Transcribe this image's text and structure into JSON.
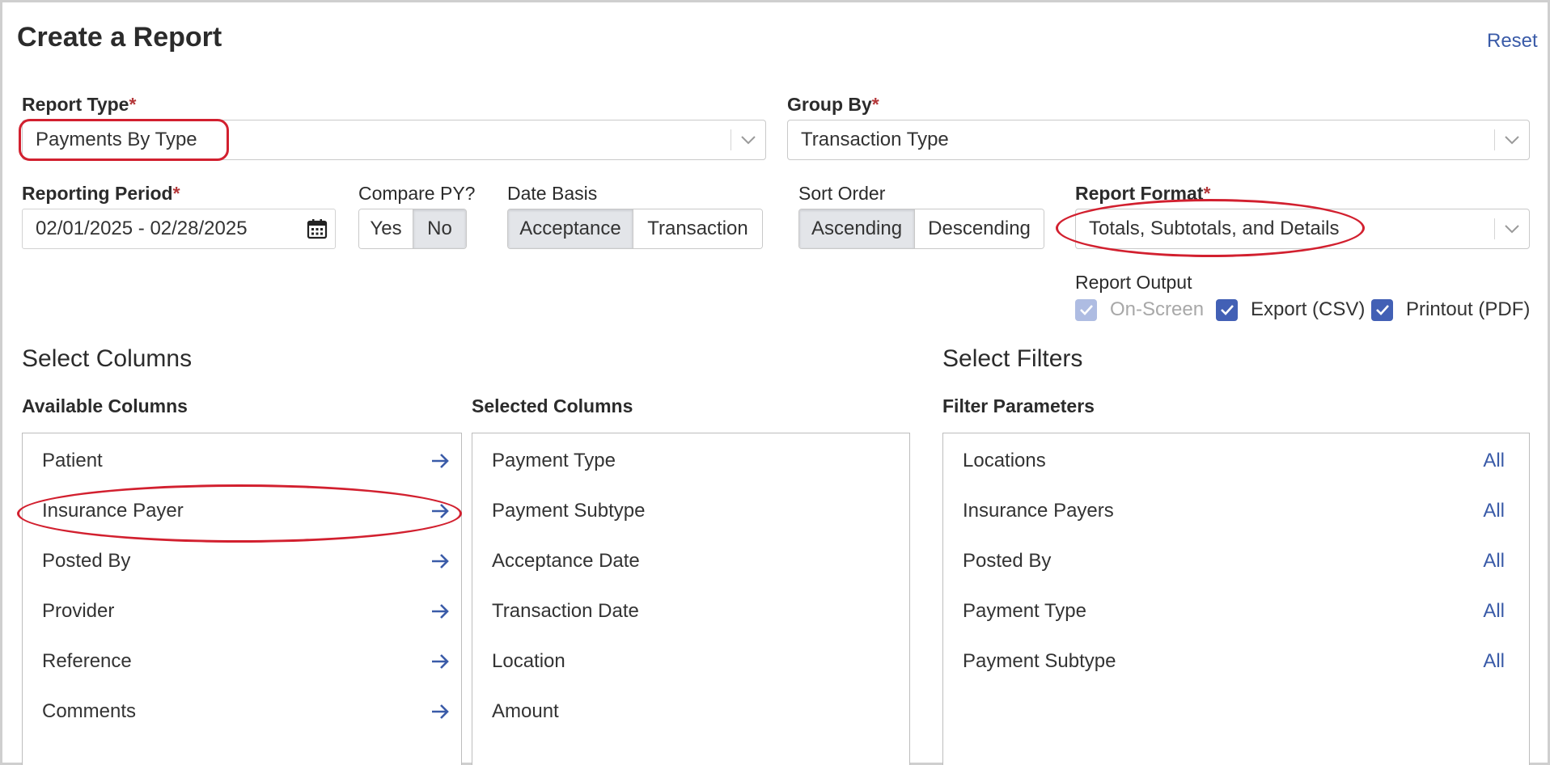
{
  "header": {
    "title": "Create a Report",
    "reset_label": "Reset"
  },
  "report_type": {
    "label": "Report Type",
    "required_mark": "*",
    "value": "Payments By Type"
  },
  "group_by": {
    "label": "Group By",
    "required_mark": "*",
    "value": "Transaction Type"
  },
  "reporting_period": {
    "label": "Reporting Period",
    "required_mark": "*",
    "value": "02/01/2025 - 02/28/2025"
  },
  "compare_py": {
    "label": "Compare PY?",
    "options": [
      "Yes",
      "No"
    ],
    "selected": "No"
  },
  "date_basis": {
    "label": "Date Basis",
    "options": [
      "Acceptance",
      "Transaction"
    ],
    "selected": "Acceptance"
  },
  "sort_order": {
    "label": "Sort Order",
    "options": [
      "Ascending",
      "Descending"
    ],
    "selected": "Ascending"
  },
  "report_format": {
    "label": "Report Format",
    "required_mark": "*",
    "value": "Totals, Subtotals, and Details"
  },
  "report_output": {
    "label": "Report Output",
    "options": [
      {
        "label": "On-Screen",
        "checked": true,
        "disabled": true
      },
      {
        "label": "Export (CSV)",
        "checked": true,
        "disabled": false
      },
      {
        "label": "Printout (PDF)",
        "checked": true,
        "disabled": false
      }
    ]
  },
  "select_columns": {
    "title": "Select Columns",
    "available_header": "Available Columns",
    "selected_header": "Selected Columns",
    "available": [
      "Patient",
      "Insurance Payer",
      "Posted By",
      "Provider",
      "Reference",
      "Comments"
    ],
    "selected": [
      "Payment Type",
      "Payment Subtype",
      "Acceptance Date",
      "Transaction Date",
      "Location",
      "Amount"
    ]
  },
  "select_filters": {
    "title": "Select Filters",
    "header": "Filter Parameters",
    "items": [
      {
        "label": "Locations",
        "value": "All"
      },
      {
        "label": "Insurance Payers",
        "value": "All"
      },
      {
        "label": "Posted By",
        "value": "All"
      },
      {
        "label": "Payment Type",
        "value": "All"
      },
      {
        "label": "Payment Subtype",
        "value": "All"
      }
    ]
  },
  "colors": {
    "accent": "#3a5ba8",
    "checkbox": "#4260b5",
    "required": "#b4383a",
    "highlight": "#d2202f",
    "segment_active": "#e3e5e9"
  }
}
